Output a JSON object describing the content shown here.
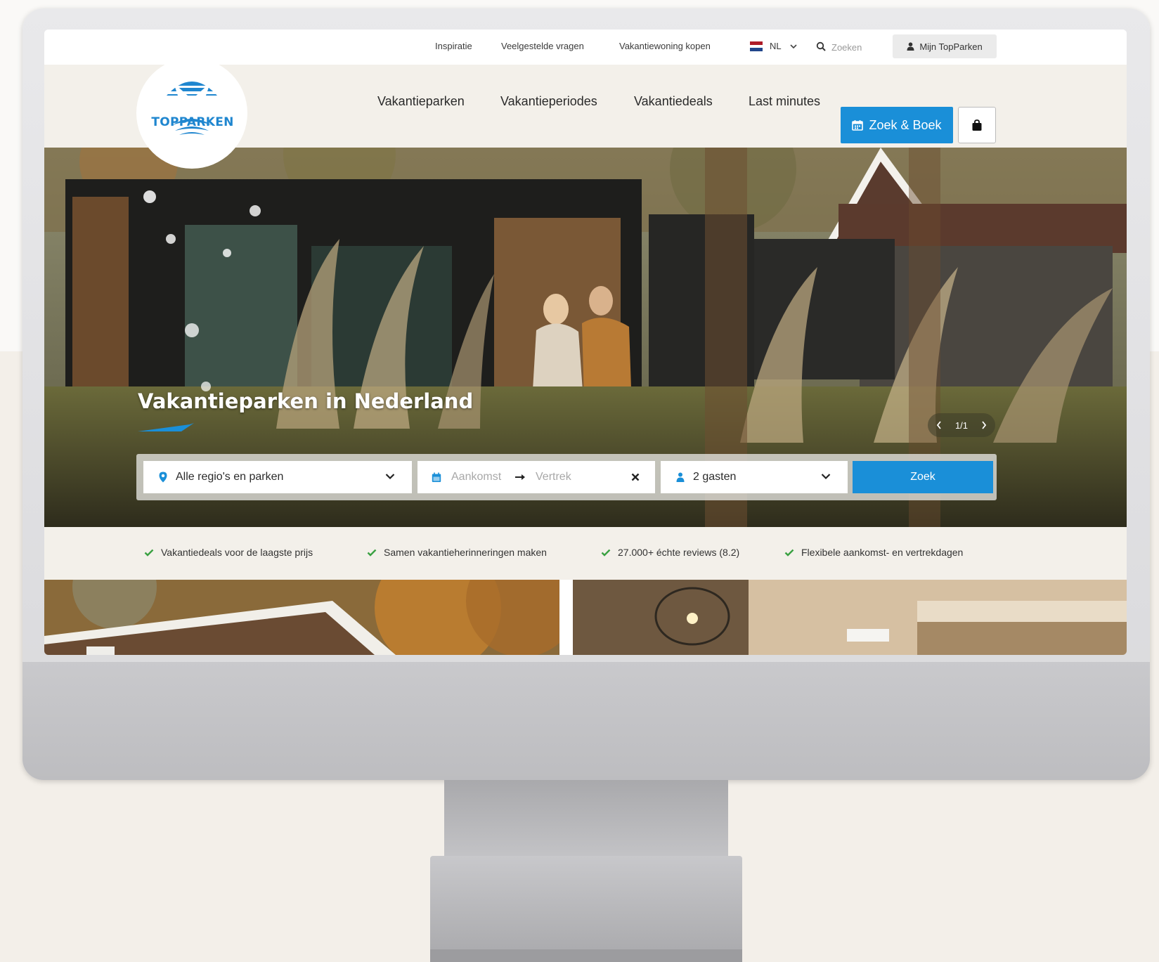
{
  "topbar": {
    "links": [
      {
        "label": "Inspiratie"
      },
      {
        "label": "Veelgestelde vragen"
      },
      {
        "label": "Vakantiewoning kopen"
      }
    ],
    "language": "NL",
    "search_placeholder": "Zoeken",
    "account_label": "Mijn TopParken"
  },
  "brand": {
    "name": "TOPPARKEN",
    "color": "#1f86cf"
  },
  "nav": {
    "items": [
      {
        "label": "Vakantieparken"
      },
      {
        "label": "Vakantieperiodes"
      },
      {
        "label": "Vakantiedeals"
      },
      {
        "label": "Last minutes"
      }
    ],
    "cta_label": "Zoek & Boek",
    "cta_color": "#1a8fd8"
  },
  "hero": {
    "title": "Vakantieparken in Nederland",
    "slide_counter": "1/1"
  },
  "search": {
    "region_value": "Alle regio's en parken",
    "arrival_placeholder": "Aankomst",
    "departure_placeholder": "Vertrek",
    "guests_value": "2 gasten",
    "submit_label": "Zoek"
  },
  "usps": [
    {
      "label": "Vakantiedeals voor de laagste prijs"
    },
    {
      "label": "Samen vakantieherinneringen maken"
    },
    {
      "label": "27.000+ échte reviews (8.2)"
    },
    {
      "label": "Flexibele aankomst- en vertrekdagen"
    }
  ],
  "colors": {
    "accent": "#1a8fd8",
    "check": "#3aa142",
    "nav_bg": "#f3f0ea"
  }
}
